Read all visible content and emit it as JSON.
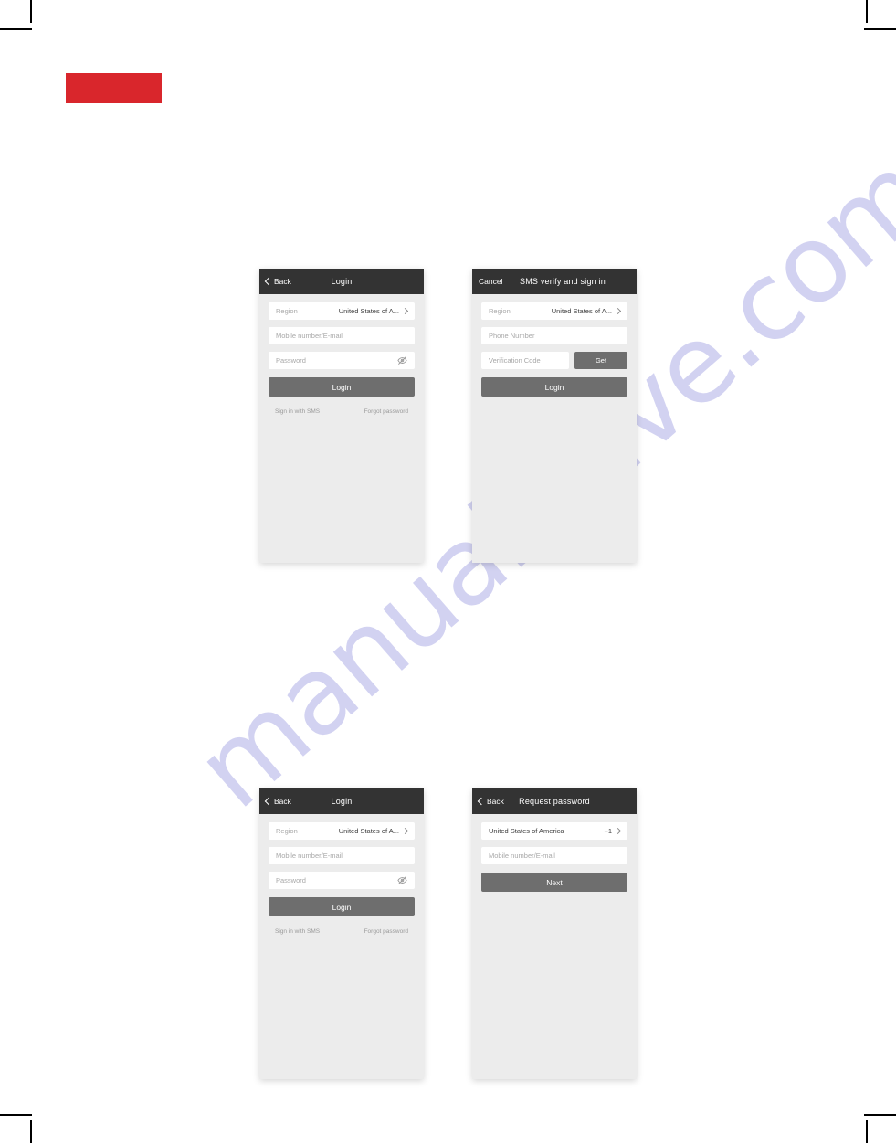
{
  "page": {
    "background_color": "#ffffff",
    "red_block_color": "#d9262c",
    "watermark": "manualshive.com",
    "watermark_color": "#c9c9ef"
  },
  "screens": [
    {
      "id": "login-top-left",
      "navbar": {
        "back_label": "Back",
        "title": "Login",
        "back_icon": "chevron-left-icon"
      },
      "fields": [
        {
          "label": "Region",
          "value": "United States of A...",
          "trailing_icon": "chevron-right-icon"
        },
        {
          "placeholder": "Mobile number/E-mail"
        },
        {
          "placeholder": "Password",
          "trailing_icon": "eye-slash-icon"
        }
      ],
      "primary_button": "Login",
      "links": {
        "left": "Sign in with SMS",
        "right": "Forgot password"
      }
    },
    {
      "id": "sms-verify-top-right",
      "navbar": {
        "back_label": "Cancel",
        "title": "SMS verify and sign in"
      },
      "fields": [
        {
          "label": "Region",
          "value": "United States of A...",
          "trailing_icon": "chevron-right-icon"
        },
        {
          "placeholder": "Phone Number"
        },
        {
          "placeholder": "Verification Code",
          "side_button": "Get"
        }
      ],
      "primary_button": "Login"
    },
    {
      "id": "login-bottom-left",
      "navbar": {
        "back_label": "Back",
        "title": "Login",
        "back_icon": "chevron-left-icon"
      },
      "fields": [
        {
          "label": "Region",
          "value": "United States of A...",
          "trailing_icon": "chevron-right-icon"
        },
        {
          "placeholder": "Mobile number/E-mail"
        },
        {
          "placeholder": "Password",
          "trailing_icon": "eye-slash-icon"
        }
      ],
      "primary_button": "Login",
      "links": {
        "left": "Sign in with SMS",
        "right": "Forgot password"
      }
    },
    {
      "id": "request-password-bottom-right",
      "navbar": {
        "back_label": "Back",
        "title": "Request password",
        "back_icon": "chevron-left-icon"
      },
      "fields": [
        {
          "label": "United States of America",
          "value": "+1",
          "trailing_icon": "chevron-right-icon"
        },
        {
          "placeholder": "Mobile number/E-mail"
        }
      ],
      "primary_button": "Next"
    }
  ]
}
